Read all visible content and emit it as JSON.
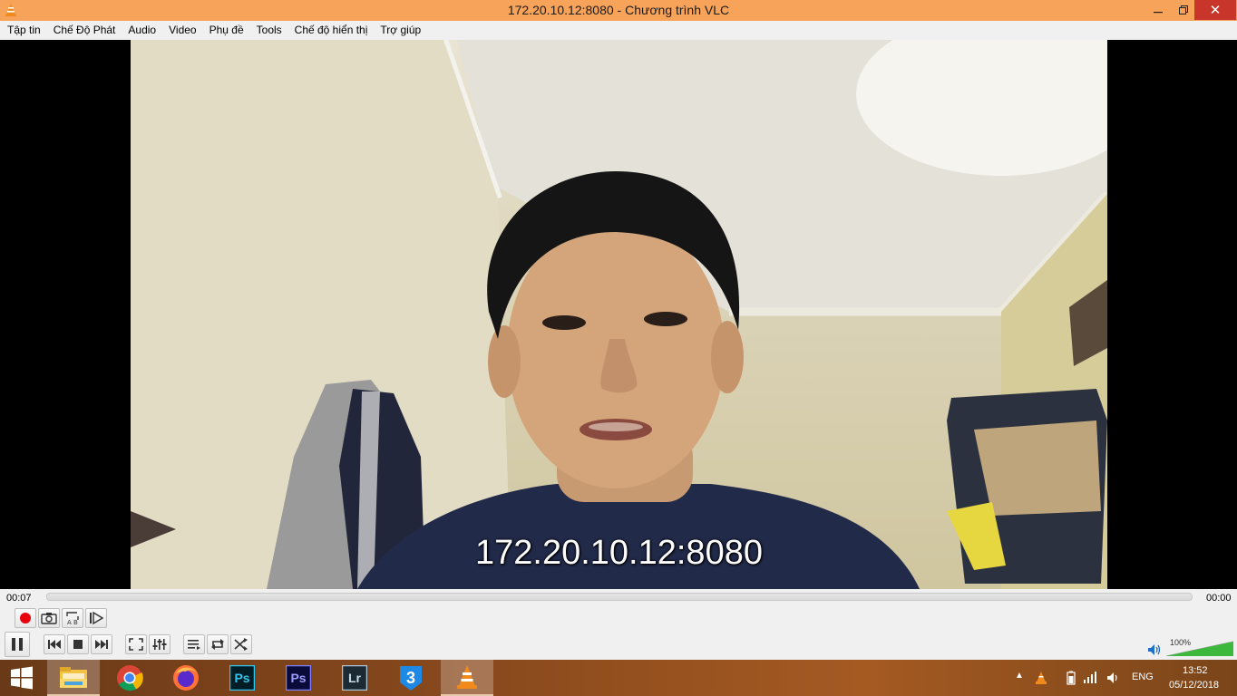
{
  "window": {
    "title": "172.20.10.12:8080 - Chương trình VLC",
    "minimize_glyph": "🗕",
    "maximize_glyph": "🗗",
    "close_glyph": "✕"
  },
  "menu": {
    "items": [
      "Tập tin",
      "Chế Độ Phát",
      "Audio",
      "Video",
      "Phụ đề",
      "Tools",
      "Chế độ hiển thị",
      "Trợ giúp"
    ]
  },
  "video": {
    "osd_text": "172.20.10.12:8080"
  },
  "playback": {
    "elapsed": "00:07",
    "total": "00:00",
    "progress": 0.0
  },
  "volume": {
    "label": "100%",
    "level": 1.0
  },
  "icons": {
    "record": "record-icon",
    "snapshot": "camera-icon",
    "ab_loop": "ab-loop-icon",
    "frame_step": "frame-step-icon",
    "pause": "pause-icon",
    "prev": "skip-back-icon",
    "stop": "stop-icon",
    "next": "skip-forward-icon",
    "fullscreen": "fullscreen-icon",
    "ext_settings": "equalizer-icon",
    "playlist": "playlist-icon",
    "loop": "loop-icon",
    "shuffle": "shuffle-icon"
  },
  "taskbar": {
    "apps": [
      "start-icon",
      "file-explorer-icon",
      "chrome-icon",
      "firefox-icon",
      "photoshop-icon",
      "photoshop-icon",
      "lightroom-icon",
      "zalo-icon",
      "vlc-icon"
    ],
    "ps_label": "Ps",
    "lr_label": "Lr",
    "three_label": "3",
    "language": "ENG",
    "time": "13:52",
    "date": "05/12/2018"
  },
  "colors": {
    "titlebar": "#f7a35a",
    "close_button": "#c7352b",
    "record_red": "#e8000d",
    "volume_green": "#3cb83c"
  }
}
